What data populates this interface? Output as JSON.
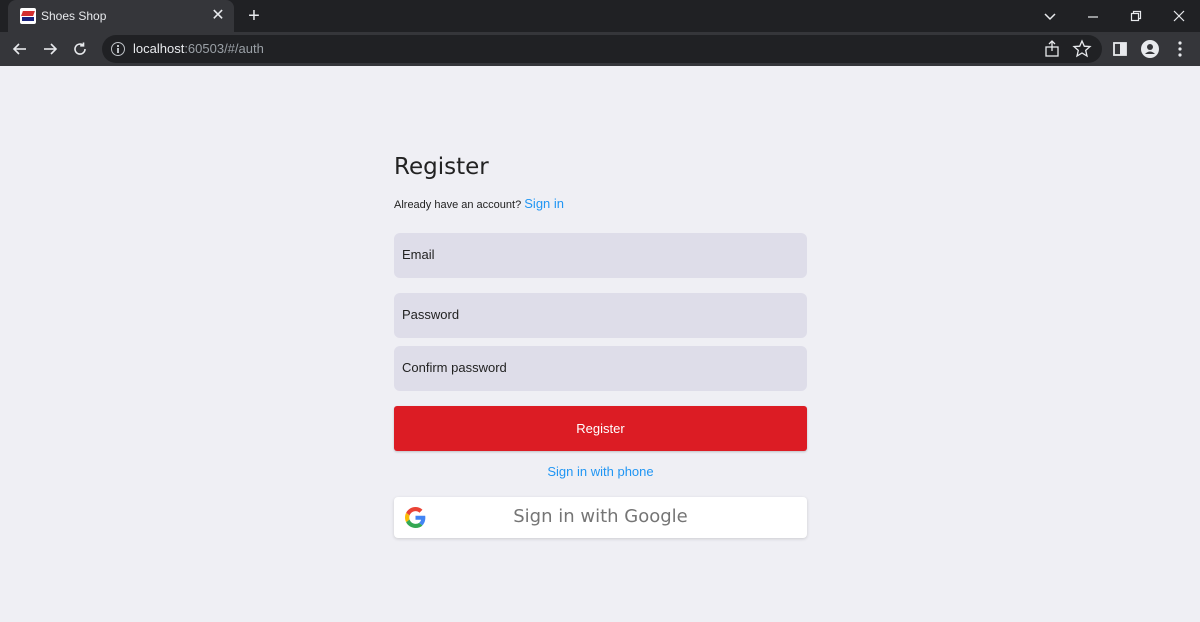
{
  "browser": {
    "tab_title": "Shoes Shop",
    "url_host": "localhost",
    "url_rest": ":60503/#/auth"
  },
  "icons": {
    "back": "arrow-left-icon",
    "forward": "arrow-right-icon",
    "reload": "reload-icon",
    "share": "share-icon",
    "bookmark": "star-icon",
    "sidepanel": "side-panel-icon",
    "profile": "profile-icon",
    "menu": "kebab-menu-icon"
  },
  "page": {
    "title": "Register",
    "have_account_text": "Already have an account?",
    "sign_in_link": "Sign in",
    "email_label": "Email",
    "password_label": "Password",
    "confirm_password_label": "Confirm password",
    "register_button": "Register",
    "phone_link": "Sign in with phone",
    "google_button": "Sign in with Google"
  },
  "colors": {
    "accent": "#dc1c24",
    "link": "#2196f3",
    "field_bg": "#dedde9",
    "page_bg": "#efeff4"
  }
}
